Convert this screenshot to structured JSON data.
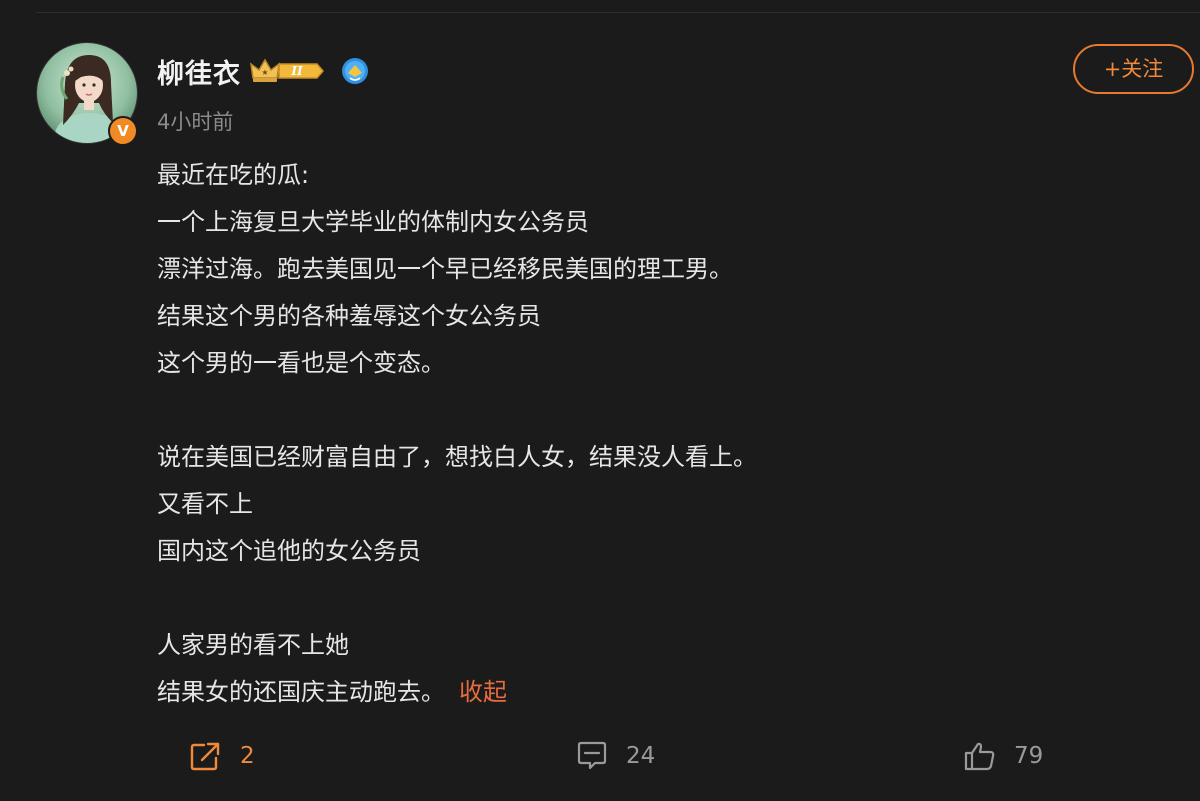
{
  "post": {
    "author": {
      "name": "柳徍衣",
      "verified_mark": "V",
      "member_level": "II",
      "avatar_icon": "avatar-portrait"
    },
    "time": "4小时前",
    "follow_label": "+关注",
    "lines": [
      "最近在吃的瓜:",
      "一个上海复旦大学毕业的体制内女公务员",
      "漂洋过海。跑去美国见一个早已经移民美国的理工男。",
      "结果这个男的各种羞辱这个女公务员",
      "这个男的一看也是个变态。",
      "",
      "说在美国已经财富自由了，想找白人女，结果没人看上。",
      "又看不上",
      "国内这个追他的女公务员",
      "",
      "人家男的看不上她",
      "结果女的还国庆主动跑去。"
    ],
    "collapse_label": "收起"
  },
  "actions": {
    "share": {
      "icon": "share-icon",
      "count": "2"
    },
    "comment": {
      "icon": "comment-icon",
      "count": "24"
    },
    "like": {
      "icon": "thumbs-up-icon",
      "count": "79"
    }
  },
  "colors": {
    "background": "#1b1b1b",
    "accent": "#f08a3a",
    "link": "#e86b3d",
    "muted": "#8a8a8a"
  }
}
